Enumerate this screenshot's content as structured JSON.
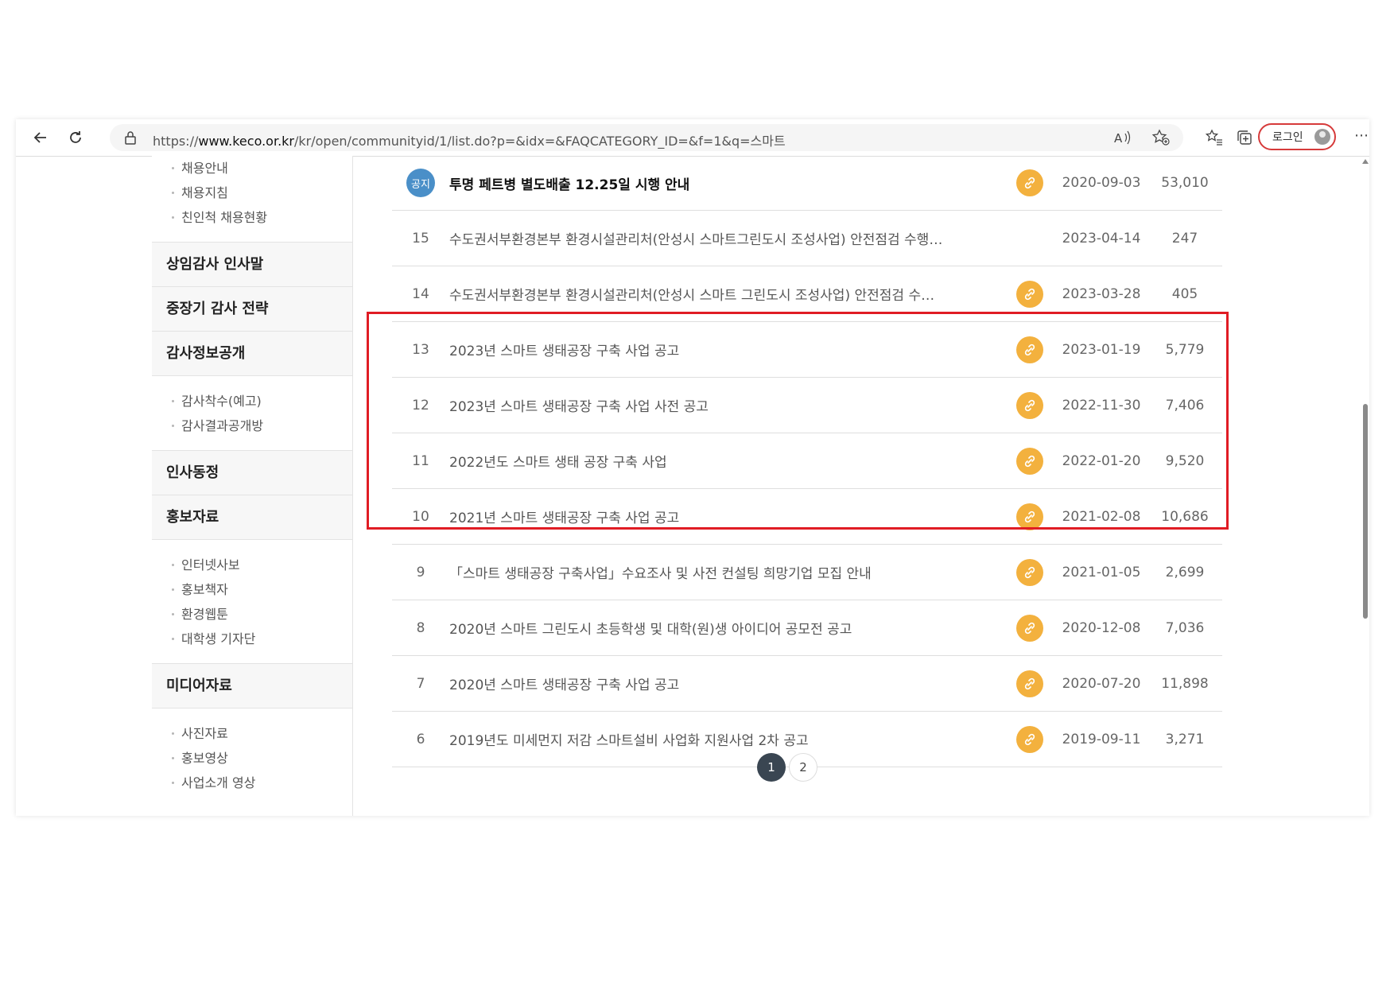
{
  "browser": {
    "url_prefix": "https://",
    "url_host": "www.keco.or.kr",
    "url_path": "/kr/open/communityid/1/list.do?p=&idx=&FAQCATEGORY_ID=&f=1&q=스마트",
    "login_label": "로그인",
    "icons": {
      "back": "arrow-left-icon",
      "reload": "reload-icon",
      "lock": "lock-icon",
      "read_aloud": "read-aloud-icon",
      "favorite_add": "star-plus-icon",
      "favorites": "favorites-icon",
      "collections": "collections-icon",
      "more": "more-icon"
    }
  },
  "sidebar": {
    "groups": [
      {
        "head": null,
        "items": [
          "채용안내",
          "채용지침",
          "친인척 채용현황"
        ]
      },
      {
        "head": "상임감사 인사말",
        "items": []
      },
      {
        "head": "중장기 감사 전략",
        "items": []
      },
      {
        "head": "감사정보공개",
        "items": [
          "감사착수(예고)",
          "감사결과공개방"
        ]
      },
      {
        "head": "인사동정",
        "items": []
      },
      {
        "head": "홍보자료",
        "items": [
          "인터넷사보",
          "홍보책자",
          "환경웹툰",
          "대학생 기자단"
        ]
      },
      {
        "head": "미디어자료",
        "items": [
          "사진자료",
          "홍보영상",
          "사업소개 영상"
        ]
      }
    ]
  },
  "notice": {
    "badge": "공지",
    "title": "투명 페트병 별도배출 12.25일 시행 안내",
    "date": "2020-09-03",
    "views": "53,010",
    "attachment": true
  },
  "rows": [
    {
      "num": "15",
      "title": "수도권서부환경본부 환경시설관리처(안성시 스마트그린도시 조성사업) 안전점검 수행…",
      "attachment": false,
      "date": "2023-04-14",
      "views": "247"
    },
    {
      "num": "14",
      "title": "수도권서부환경본부 환경시설관리처(안성시 스마트 그린도시 조성사업) 안전점검 수…",
      "attachment": true,
      "date": "2023-03-28",
      "views": "405"
    },
    {
      "num": "13",
      "title": "2023년 스마트 생태공장 구축 사업 공고",
      "attachment": true,
      "date": "2023-01-19",
      "views": "5,779"
    },
    {
      "num": "12",
      "title": "2023년 스마트 생태공장 구축 사업 사전 공고",
      "attachment": true,
      "date": "2022-11-30",
      "views": "7,406"
    },
    {
      "num": "11",
      "title": "2022년도 스마트 생태 공장 구축 사업",
      "attachment": true,
      "date": "2022-01-20",
      "views": "9,520"
    },
    {
      "num": "10",
      "title": "2021년 스마트 생태공장 구축 사업 공고",
      "attachment": true,
      "date": "2021-02-08",
      "views": "10,686"
    },
    {
      "num": "9",
      "title": "「스마트 생태공장 구축사업」수요조사 및 사전 컨설팅 희망기업 모집 안내",
      "attachment": true,
      "date": "2021-01-05",
      "views": "2,699"
    },
    {
      "num": "8",
      "title": "2020년 스마트 그린도시 초등학생 및 대학(원)생 아이디어 공모전 공고",
      "attachment": true,
      "date": "2020-12-08",
      "views": "7,036"
    },
    {
      "num": "7",
      "title": "2020년 스마트 생태공장 구축 사업 공고",
      "attachment": true,
      "date": "2020-07-20",
      "views": "11,898"
    },
    {
      "num": "6",
      "title": "2019년도 미세먼지 저감 스마트설비 사업화 지원사업 2차 공고",
      "attachment": true,
      "date": "2019-09-11",
      "views": "3,271"
    }
  ],
  "pagination": {
    "pages": [
      "1",
      "2"
    ],
    "current": "1"
  },
  "colors": {
    "highlight": "#e01c24",
    "attach": "#f3b13e",
    "notice_badge": "#4a8fc8",
    "page_active": "#3a4652"
  }
}
